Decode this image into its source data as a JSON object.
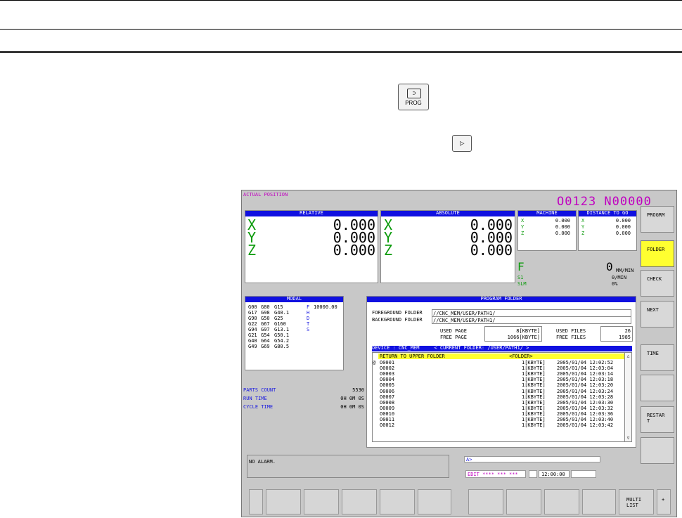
{
  "keys": {
    "prog_label": "PROG"
  },
  "screen": {
    "title": "ACTUAL POSITION",
    "prog_number": "O0123 N00000",
    "relative": {
      "header": "RELATIVE",
      "axes": [
        {
          "name": "X",
          "value": "0.000"
        },
        {
          "name": "Y",
          "value": "0.000"
        },
        {
          "name": "Z",
          "value": "0.000"
        }
      ]
    },
    "absolute": {
      "header": "ABSOLUTE",
      "axes": [
        {
          "name": "X",
          "value": "0.000"
        },
        {
          "name": "Y",
          "value": "0.000"
        },
        {
          "name": "Z",
          "value": "0.000"
        }
      ]
    },
    "machine": {
      "header": "MACHINE",
      "axes": [
        {
          "name": "X",
          "value": "0.000"
        },
        {
          "name": "Y",
          "value": "0.000"
        },
        {
          "name": "Z",
          "value": "0.000"
        }
      ]
    },
    "distance": {
      "header": "DISTANCE TO GO",
      "axes": [
        {
          "name": "X",
          "value": "0.000"
        },
        {
          "name": "Y",
          "value": "0.000"
        },
        {
          "name": "Z",
          "value": "0.000"
        }
      ]
    },
    "feed": {
      "letter": "F",
      "value": "0",
      "unit": "MM/MIN",
      "s1": "S1",
      "s1_value": "0/MIN",
      "slm": "SLM",
      "slm_value": "0%"
    },
    "modal": {
      "header": "MODAL",
      "rows": [
        {
          "g1": "G00",
          "g2": "G80",
          "g3": "G15",
          "code": "F",
          "value": "10000.00"
        },
        {
          "g1": "G17",
          "g2": "G98",
          "g3": "G40.1",
          "code": "H",
          "value": ""
        },
        {
          "g1": "G90",
          "g2": "G50",
          "g3": "G25",
          "code": "D",
          "value": ""
        },
        {
          "g1": "G22",
          "g2": "G67",
          "g3": "G160",
          "code": "T",
          "value": ""
        },
        {
          "g1": "G94",
          "g2": "G97",
          "g3": "G13.1",
          "code": "S",
          "value": ""
        },
        {
          "g1": "G21",
          "g2": "G54",
          "g3": "G50.1",
          "code": "",
          "value": ""
        },
        {
          "g1": "G40",
          "g2": "G64",
          "g3": "G54.2",
          "code": "",
          "value": ""
        },
        {
          "g1": "G49",
          "g2": "G69",
          "g3": "G80.5",
          "code": "",
          "value": ""
        }
      ]
    },
    "counters": [
      {
        "label": "PARTS COUNT",
        "value": "5530"
      },
      {
        "label": "RUN TIME",
        "value": "0H 0M 0S"
      },
      {
        "label": "CYCLE TIME",
        "value": "0H 0M 0S"
      }
    ],
    "folder": {
      "header": "PROGRAM FOLDER",
      "fg_label": "FOREGROUND FOLDER",
      "fg_value": "//CNC_MEM/USER/PATH1/",
      "bg_label": "BACKGROUND FOLDER",
      "bg_value": "//CNC_MEM/USER/PATH1/",
      "used_page_label": "USED PAGE",
      "free_page_label": "FREE PAGE",
      "used_page": "8[KBYTE]",
      "free_page": "1066[KBYTE]",
      "used_files_label": "USED FILES",
      "free_files_label": "FREE FILES",
      "used_files": "26",
      "free_files": "1985",
      "device_bar": "DEVICE : CNC_MEM     < CURRENT FOLDER: /USER/PATH1/ >",
      "return_row": "RETURN TO UPPER FOLDER",
      "return_tag": "<FOLDER>",
      "marker": "@",
      "files": [
        {
          "name": "O0001",
          "size": "1[KBYTE]",
          "date": "2005/01/04 12:02:52"
        },
        {
          "name": "O0002",
          "size": "1[KBYTE]",
          "date": "2005/01/04 12:03:04"
        },
        {
          "name": "O0003",
          "size": "1[KBYTE]",
          "date": "2005/01/04 12:03:14"
        },
        {
          "name": "O0004",
          "size": "1[KBYTE]",
          "date": "2005/01/04 12:03:18"
        },
        {
          "name": "O0005",
          "size": "1[KBYTE]",
          "date": "2005/01/04 12:03:20"
        },
        {
          "name": "O0006",
          "size": "1[KBYTE]",
          "date": "2005/01/04 12:03:24"
        },
        {
          "name": "O0007",
          "size": "1[KBYTE]",
          "date": "2005/01/04 12:03:28"
        },
        {
          "name": "O0008",
          "size": "1[KBYTE]",
          "date": "2005/01/04 12:03:30"
        },
        {
          "name": "O0009",
          "size": "1[KBYTE]",
          "date": "2005/01/04 12:03:32"
        },
        {
          "name": "O0010",
          "size": "1[KBYTE]",
          "date": "2005/01/04 12:03:36"
        },
        {
          "name": "O0011",
          "size": "1[KBYTE]",
          "date": "2005/01/04 12:03:40"
        },
        {
          "name": "O0012",
          "size": "1[KBYTE]",
          "date": "2005/01/04 12:03:42"
        }
      ]
    },
    "alarm": "NO ALARM.",
    "input_prompt": "A>",
    "mode": "EDIT **** *** ***",
    "clock": "12:00:00",
    "softkeys": [
      {
        "label": "PROGRM",
        "active": false
      },
      {
        "label": "FOLDER",
        "active": true
      },
      {
        "label": "CHECK",
        "active": false
      },
      {
        "label": "NEXT",
        "active": false
      },
      {
        "label": "TIME",
        "active": false
      },
      {
        "label": "",
        "active": false
      },
      {
        "label": "RESTAR\nT",
        "active": false
      },
      {
        "label": "",
        "active": false
      }
    ],
    "bottom_keys": {
      "multi_list": "MULTI\nLIST",
      "plus": "+"
    }
  }
}
